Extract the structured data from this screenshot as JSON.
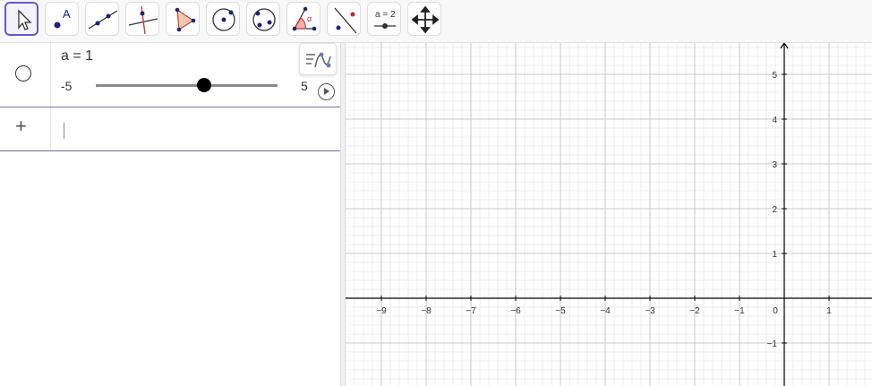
{
  "colors": {
    "selection": "#6557d2",
    "point": "#1a237e",
    "row_separator": "#7b6ab1",
    "grid_major": "#c8c8c8",
    "grid_minor": "#ececec"
  },
  "toolbar": {
    "tools": [
      {
        "name": "move-tool",
        "icon": "arrow-cursor-icon",
        "selected": true
      },
      {
        "name": "point-tool",
        "icon": "point-icon",
        "label": "A"
      },
      {
        "name": "line-tool",
        "icon": "line-icon"
      },
      {
        "name": "perpendicular-line-tool",
        "icon": "perpendicular-line-icon"
      },
      {
        "name": "polygon-tool",
        "icon": "polygon-icon"
      },
      {
        "name": "circle-center-point-tool",
        "icon": "circle-center-icon"
      },
      {
        "name": "circle-three-points-tool",
        "icon": "circle-three-points-icon"
      },
      {
        "name": "angle-tool",
        "icon": "angle-icon",
        "label": "α"
      },
      {
        "name": "reflect-tool",
        "icon": "reflect-icon"
      },
      {
        "name": "slider-tool",
        "icon": "slider-icon",
        "label": "a = 2"
      },
      {
        "name": "move-graphics-view-tool",
        "icon": "move-arrows-icon"
      }
    ]
  },
  "algebra": {
    "slider": {
      "expression": "a = 1",
      "min": "-5",
      "max": "5",
      "value": 1
    },
    "input_placeholder": ""
  },
  "graphics": {
    "x_axis": {
      "min": -10,
      "max": 2,
      "ticks": [
        "−9",
        "−8",
        "−7",
        "−6",
        "−5",
        "−4",
        "−3",
        "−2",
        "−1",
        "0",
        "1"
      ]
    },
    "y_axis": {
      "ticks": [
        "5",
        "4",
        "3",
        "2",
        "1",
        "−1"
      ]
    }
  }
}
